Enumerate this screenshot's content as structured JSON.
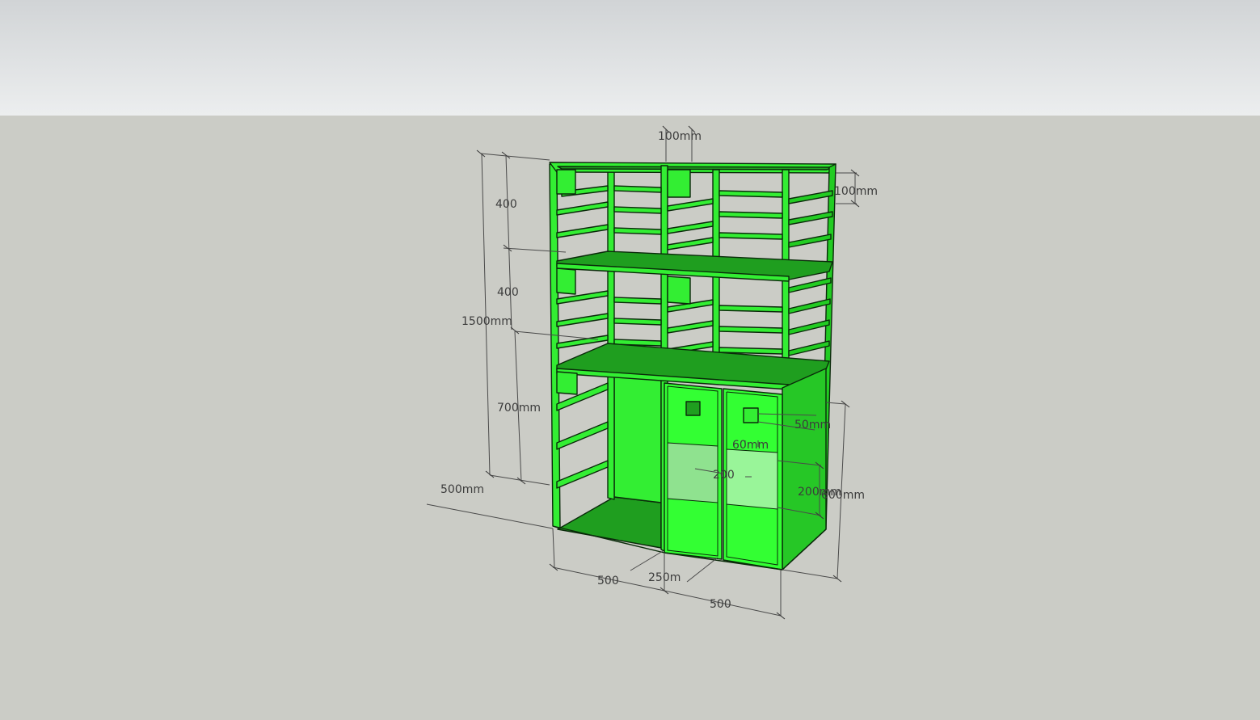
{
  "colors": {
    "frame": "#33ee33",
    "frame_side": "#22cc22",
    "shelf_top": "#1f9e1f",
    "panel": "#33ff33",
    "side_panel": "#26c726",
    "window": "#8fe28f",
    "window_light": "#99f599",
    "edge": "#0a2a0a",
    "sky_top": "#d1d4d6",
    "sky_bottom": "#eceeef",
    "ground": "#cbccc6",
    "dimension_text": "#3c3c3c"
  },
  "dimensions": {
    "top_width": "100mm",
    "top_depth": "100mm",
    "upper_shelf_height": "400",
    "middle_shelf_height": "400",
    "total_height": "1500mm",
    "lower_section_height": "700mm",
    "depth_left": "500mm",
    "handle_width": "50mm",
    "handle_height": "60mm",
    "window_width": "200",
    "window_height": "200mm",
    "door_height": "600mm",
    "bottom_left_width": "500",
    "bottom_gap": "250m",
    "bottom_right_width": "500"
  }
}
